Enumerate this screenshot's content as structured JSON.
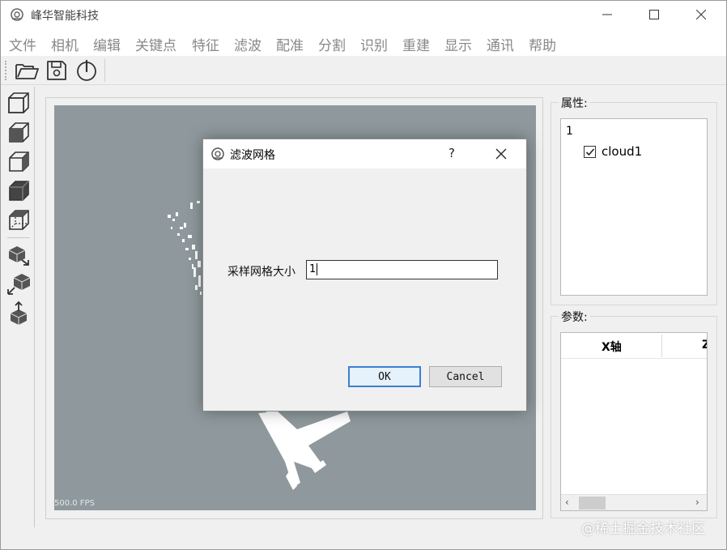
{
  "window": {
    "title": "峰华智能科技",
    "icon": "app-logo-icon"
  },
  "menu": {
    "items": [
      {
        "label": "文件"
      },
      {
        "label": "相机"
      },
      {
        "label": "编辑"
      },
      {
        "label": "关键点"
      },
      {
        "label": "特征"
      },
      {
        "label": "滤波"
      },
      {
        "label": "配准"
      },
      {
        "label": "分割"
      },
      {
        "label": "识别"
      },
      {
        "label": "重建"
      },
      {
        "label": "显示"
      },
      {
        "label": "通讯"
      },
      {
        "label": "帮助"
      }
    ]
  },
  "toolbar": {
    "buttons": [
      "open-folder-icon",
      "save-icon",
      "power-icon"
    ]
  },
  "left_tools": [
    "view-front-cube-icon",
    "view-top-cube-icon",
    "view-side-cube-icon",
    "view-solid-cube-icon",
    "view-iso-cube-icon",
    "cube-export-icon",
    "cube-rotate-icon",
    "cube-upload-icon"
  ],
  "viewer": {
    "fps_text": "500.0 FPS",
    "background_color": "#8f999d"
  },
  "properties": {
    "title": "属性:",
    "tree_root": "1",
    "tree_child": "cloud1",
    "tree_child_checked": true
  },
  "parameters": {
    "title": "参数:",
    "columns": [
      "X轴",
      "Z"
    ]
  },
  "dialog": {
    "title": "滤波网格",
    "help": "?",
    "field_label": "采样网格大小",
    "field_value": "1",
    "ok_label": "OK",
    "cancel_label": "Cancel"
  },
  "watermark": "@稀土掘金技术社区"
}
